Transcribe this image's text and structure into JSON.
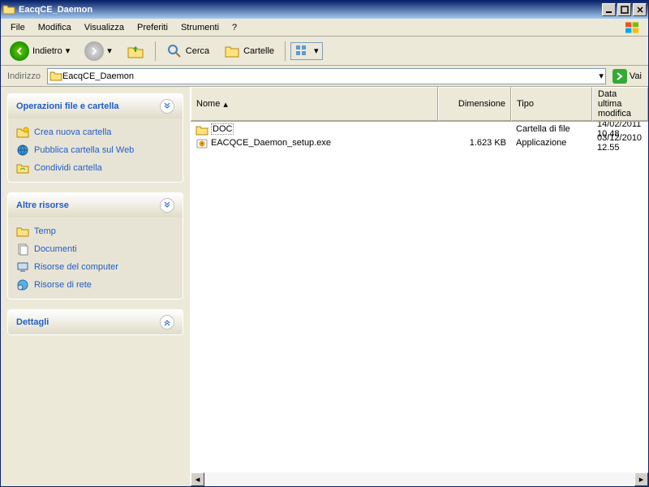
{
  "window": {
    "title": "EacqCE_Daemon"
  },
  "menu": {
    "file": "File",
    "modifica": "Modifica",
    "visualizza": "Visualizza",
    "preferiti": "Preferiti",
    "strumenti": "Strumenti",
    "help": "?"
  },
  "toolbar": {
    "back": "Indietro",
    "search": "Cerca",
    "folders": "Cartelle"
  },
  "address": {
    "label": "Indirizzo",
    "value": "EacqCE_Daemon",
    "go": "Vai"
  },
  "sidebar": {
    "panel1": {
      "title": "Operazioni file e cartella",
      "items": [
        {
          "label": "Crea nuova cartella",
          "icon": "new-folder"
        },
        {
          "label": "Pubblica cartella sul Web",
          "icon": "publish-web"
        },
        {
          "label": "Condividi cartella",
          "icon": "share-folder"
        }
      ]
    },
    "panel2": {
      "title": "Altre risorse",
      "items": [
        {
          "label": "Temp",
          "icon": "folder"
        },
        {
          "label": "Documenti",
          "icon": "documents"
        },
        {
          "label": "Risorse del computer",
          "icon": "computer"
        },
        {
          "label": "Risorse di rete",
          "icon": "network"
        }
      ]
    },
    "panel3": {
      "title": "Dettagli"
    }
  },
  "columns": {
    "name": "Nome",
    "size": "Dimensione",
    "type": "Tipo",
    "date": "Data ultima modifica"
  },
  "files": [
    {
      "name": "DOC",
      "size": "",
      "type": "Cartella di file",
      "date": "14/02/2011 10.48",
      "icon": "folder",
      "selected": true
    },
    {
      "name": "EACQCE_Daemon_setup.exe",
      "size": "1.623 KB",
      "type": "Applicazione",
      "date": "03/12/2010 12.55",
      "icon": "exe",
      "selected": false
    }
  ]
}
